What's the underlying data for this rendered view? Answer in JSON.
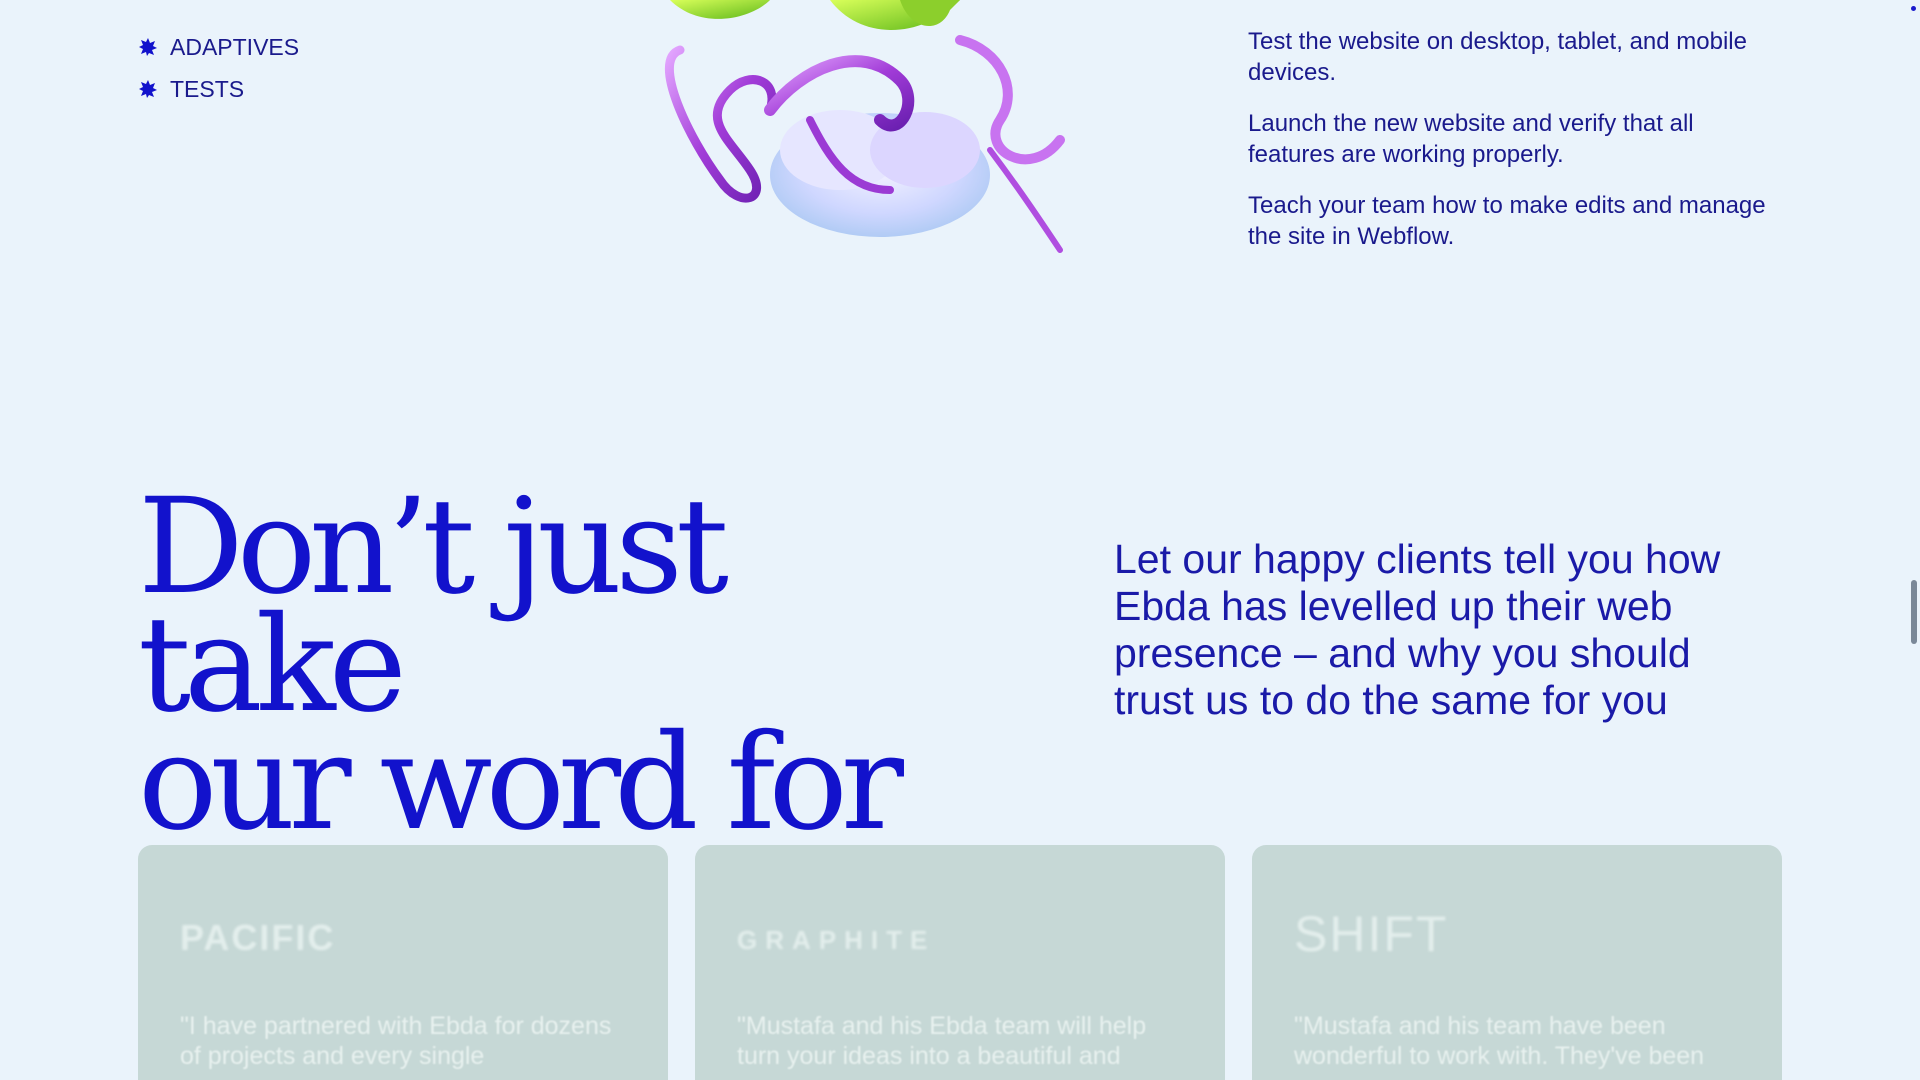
{
  "services_list": [
    "ADAPTIVES",
    "TESTS"
  ],
  "steps": [
    "Test the website on desktop, tablet, and mobile devices.",
    "Launch the new website and verify that all features are working properly.",
    "Teach your team how to make edits and manage the site in Webflow."
  ],
  "testimonials": {
    "headline_line1": "Don’t just take",
    "headline_line2": "our word for it.",
    "intro": "Let our happy clients tell you how Ebda has levelled up their web presence – and why you should trust us to do the same for you",
    "cards": [
      {
        "logo": "PACIFIC",
        "quote": "\"I have partnered with Ebda for dozens of projects and every single"
      },
      {
        "logo": "GRAPHITE",
        "quote": "\"Mustafa and his Ebda team will help turn your ideas into a beautiful and"
      },
      {
        "logo": "SHIFT",
        "quote": "\"Mustafa and his team have been wonderful to work with. They've been"
      }
    ]
  },
  "colors": {
    "background": "#eaf3fb",
    "accent_blue": "#1212cc",
    "text_navy": "#1a1a8c",
    "card_bg": "#c6d8d6"
  },
  "icons": {
    "bullet": "star-bullet-icon"
  }
}
